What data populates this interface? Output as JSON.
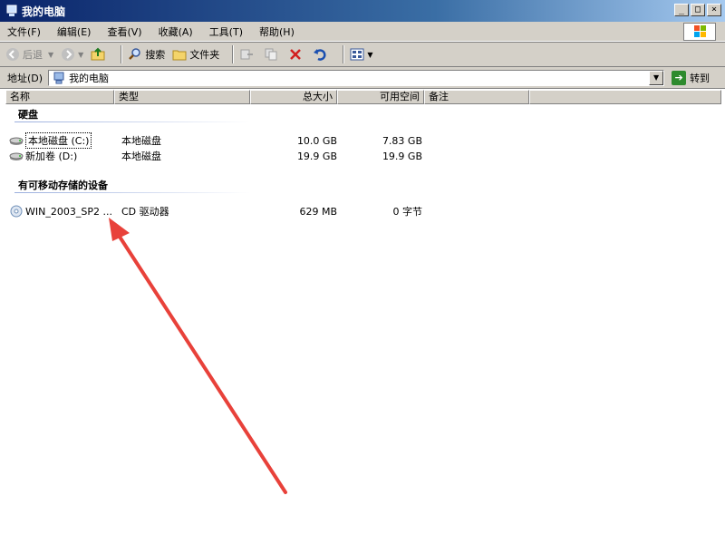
{
  "window": {
    "title": "我的电脑",
    "controls": {
      "minimize": "_",
      "maximize": "□",
      "close": "×"
    }
  },
  "menu": [
    "文件(F)",
    "编辑(E)",
    "查看(V)",
    "收藏(A)",
    "工具(T)",
    "帮助(H)"
  ],
  "toolbar": {
    "back": "后退",
    "search": "搜索",
    "folders": "文件夹"
  },
  "address": {
    "label": "地址(D)",
    "value": "我的电脑",
    "go": "转到"
  },
  "columns": [
    "名称",
    "类型",
    "总大小",
    "可用空间",
    "备注"
  ],
  "groups": [
    {
      "title": "硬盘",
      "items": [
        {
          "name": "本地磁盘 (C:)",
          "type": "本地磁盘",
          "total": "10.0 GB",
          "free": "7.83 GB"
        },
        {
          "name": "新加卷 (D:)",
          "type": "本地磁盘",
          "total": "19.9 GB",
          "free": "19.9 GB"
        }
      ]
    },
    {
      "title": "有可移动存储的设备",
      "items": [
        {
          "name": "WIN_2003_SP2 ...",
          "type": "CD 驱动器",
          "total": "629 MB",
          "free": "0 字节"
        }
      ]
    }
  ],
  "colors": {
    "title_start": "#0a246a",
    "title_end": "#a6caf0",
    "chrome": "#d4d0c8",
    "arrow": "#e8413a"
  }
}
